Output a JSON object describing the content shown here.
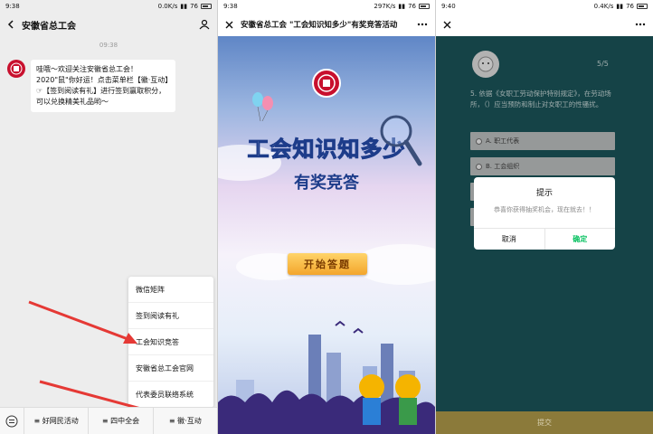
{
  "panel1": {
    "status": {
      "time": "9:38",
      "net": "0.0K/s",
      "battery_pct": "76"
    },
    "nav": {
      "title": "安徽省总工会"
    },
    "chat": {
      "timestamp": "09:38",
      "message": "哇哦～欢迎关注安徽省总工会！2020\"鼠\"你好运！点击菜单栏【徽·互动】☞【签到阅读有礼】进行签到赢取积分，可以兑换精美礼品哟～"
    },
    "menu": {
      "items": [
        "微信矩阵",
        "签到阅读有礼",
        "工会知识竞答",
        "安徽省总工会官网",
        "代表委员联络系统"
      ]
    },
    "bottom_tabs": [
      "≡ 好网民活动",
      "≡ 四中全会",
      "≡ 徽·互动"
    ]
  },
  "panel2": {
    "status": {
      "time": "9:38",
      "net": "297K/s",
      "battery_pct": "76"
    },
    "nav": {
      "title": "安徽省总工会 \"工会知识知多少\"有奖竞答活动"
    },
    "hero": {
      "title": "工会知识知多少",
      "subtitle": "有奖竞答"
    },
    "start_label": "开始答题"
  },
  "panel3": {
    "status": {
      "time": "9:40",
      "net": "0.4K/s",
      "battery_pct": "76"
    },
    "question": {
      "count": "5/5",
      "text": "5. 依据《女职工劳动保护特别规定》，在劳动场所，（）应当预防和制止对女职工的性骚扰。",
      "options": [
        "A. 职工代表",
        "B. 工会组织",
        "C.",
        "D."
      ]
    },
    "dialog": {
      "title": "提示",
      "message": "恭喜你获得抽奖机会，现在就去！！",
      "cancel": "取消",
      "confirm": "确定"
    },
    "submit_label": "提交"
  },
  "colors": {
    "wechat_green": "#07c160",
    "arrow_red": "#e53935",
    "teal_bg": "#1d5a5f",
    "brand_red": "#c8102e"
  }
}
